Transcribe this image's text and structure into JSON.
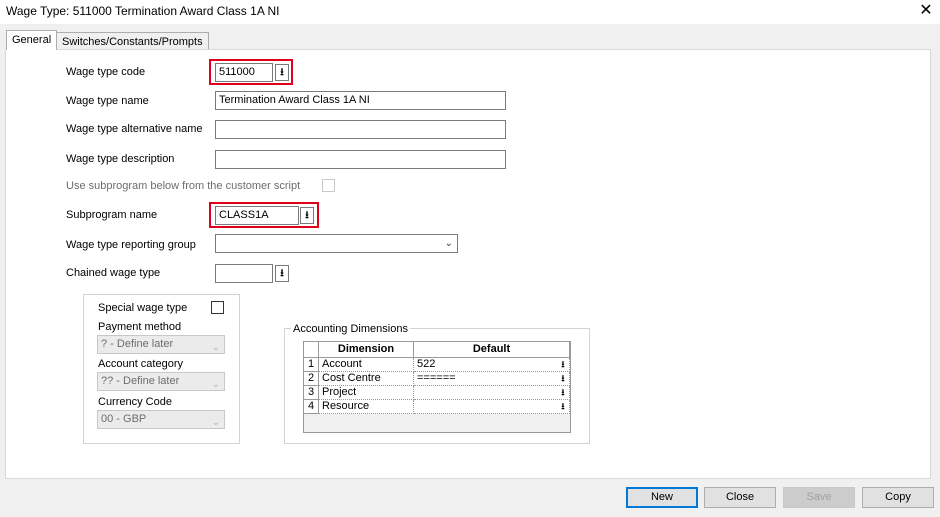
{
  "window": {
    "title": "Wage Type: 511000 Termination Award Class 1A NI",
    "close_glyph": "✕"
  },
  "tabs": [
    {
      "label": "General",
      "active": true
    },
    {
      "label": "Switches/Constants/Prompts",
      "active": false
    }
  ],
  "form": {
    "wage_type_code": {
      "label": "Wage type code",
      "value": "511000"
    },
    "wage_type_name": {
      "label": "Wage type name",
      "value": "Termination Award Class 1A NI"
    },
    "wage_type_alt_name": {
      "label": "Wage type alternative name",
      "value": ""
    },
    "wage_type_description": {
      "label": "Wage type description",
      "value": ""
    },
    "use_subprogram": {
      "label": "Use subprogram below from the customer script",
      "checked": false
    },
    "subprogram_name": {
      "label": "Subprogram name",
      "value": "CLASS1A"
    },
    "reporting_group": {
      "label": "Wage type reporting group",
      "value": ""
    },
    "chained_wage_type": {
      "label": "Chained wage type",
      "value": ""
    },
    "lookup_glyph": "⭳"
  },
  "special": {
    "special_wage_type": {
      "label": "Special wage type",
      "checked": false
    },
    "payment_method": {
      "label": "Payment method",
      "value": "? - Define later"
    },
    "account_category": {
      "label": "Account category",
      "value": "?? - Define later"
    },
    "currency_code": {
      "label": "Currency Code",
      "value": "00 - GBP"
    }
  },
  "accounting": {
    "title": "Accounting Dimensions",
    "columns": [
      "Dimension",
      "Default"
    ],
    "rows": [
      {
        "num": "1",
        "dimension": "Account",
        "default": "522"
      },
      {
        "num": "2",
        "dimension": "Cost Centre",
        "default": "======"
      },
      {
        "num": "3",
        "dimension": "Project",
        "default": ""
      },
      {
        "num": "4",
        "dimension": "Resource",
        "default": ""
      }
    ]
  },
  "buttons": {
    "new": "New",
    "close": "Close",
    "save": "Save",
    "copy": "Copy"
  },
  "colors": {
    "highlight": "#e0001b",
    "default_button_border": "#0078d7"
  }
}
